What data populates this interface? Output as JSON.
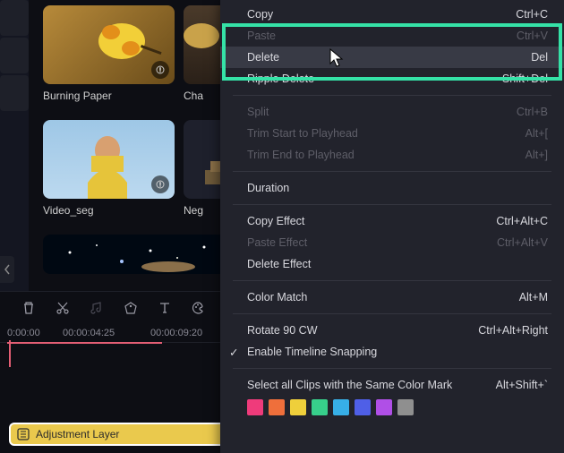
{
  "media": {
    "items": [
      {
        "label": "Burning Paper"
      },
      {
        "label": "Cha"
      },
      {
        "label": "Video_seg"
      },
      {
        "label": "Neg"
      }
    ]
  },
  "timeline": {
    "timecodes": [
      "0:00:00",
      "00:00:04:25",
      "00:00:09:20"
    ],
    "adjustment_layer_label": "Adjustment Layer"
  },
  "context_menu": {
    "items": [
      {
        "label": "Copy",
        "shortcut": "Ctrl+C",
        "disabled": false
      },
      {
        "label": "Paste",
        "shortcut": "Ctrl+V",
        "disabled": true
      },
      {
        "label": "Delete",
        "shortcut": "Del",
        "disabled": false,
        "hovered": true
      },
      {
        "label": "Ripple Delete",
        "shortcut": "Shift+Del",
        "disabled": false
      },
      {
        "sep": true
      },
      {
        "label": "Split",
        "shortcut": "Ctrl+B",
        "disabled": true
      },
      {
        "label": "Trim Start to Playhead",
        "shortcut": "Alt+[",
        "disabled": true
      },
      {
        "label": "Trim End to Playhead",
        "shortcut": "Alt+]",
        "disabled": true
      },
      {
        "sep": true
      },
      {
        "label": "Duration",
        "shortcut": "",
        "disabled": false
      },
      {
        "sep": true
      },
      {
        "label": "Copy Effect",
        "shortcut": "Ctrl+Alt+C",
        "disabled": false
      },
      {
        "label": "Paste Effect",
        "shortcut": "Ctrl+Alt+V",
        "disabled": true
      },
      {
        "label": "Delete Effect",
        "shortcut": "",
        "disabled": false
      },
      {
        "sep": true
      },
      {
        "label": "Color Match",
        "shortcut": "Alt+M",
        "disabled": false
      },
      {
        "sep": true
      },
      {
        "label": "Rotate 90 CW",
        "shortcut": "Ctrl+Alt+Right",
        "disabled": false
      },
      {
        "label": "Enable Timeline Snapping",
        "shortcut": "",
        "disabled": false,
        "checked": true
      },
      {
        "sep": true
      },
      {
        "label": "Select all Clips with the Same Color Mark",
        "shortcut": "Alt+Shift+`",
        "disabled": false
      }
    ],
    "colors": [
      "#ef3b7b",
      "#ef6f3b",
      "#efcf3b",
      "#37cf8b",
      "#37afe7",
      "#4f5fe7",
      "#b04fe7",
      "#8f8f8f"
    ]
  }
}
